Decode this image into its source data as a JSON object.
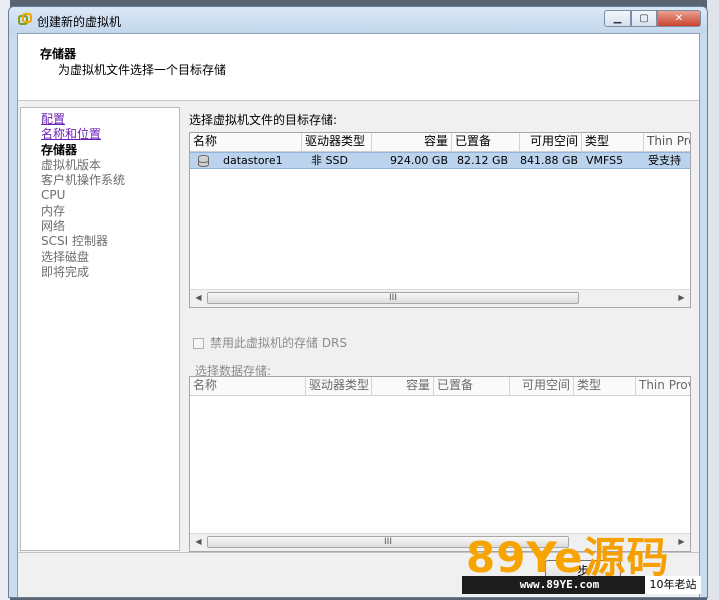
{
  "window": {
    "title": "创建新的虚拟机",
    "min_glyph": "▁",
    "max_glyph": "▢",
    "close_glyph": "✕"
  },
  "header": {
    "title": "存储器",
    "subtitle": "为虚拟机文件选择一个目标存储"
  },
  "nav": [
    {
      "label": "配置",
      "state": "link"
    },
    {
      "label": "名称和位置",
      "state": "link"
    },
    {
      "label": "存储器",
      "state": "current"
    },
    {
      "label": "虚拟机版本",
      "state": "normal"
    },
    {
      "label": "客户机操作系统",
      "state": "normal"
    },
    {
      "label": "CPU",
      "state": "normal"
    },
    {
      "label": "内存",
      "state": "normal"
    },
    {
      "label": "网络",
      "state": "normal"
    },
    {
      "label": "SCSI 控制器",
      "state": "normal"
    },
    {
      "label": "选择磁盘",
      "state": "normal"
    },
    {
      "label": "即将完成",
      "state": "normal"
    }
  ],
  "main": {
    "select_label": "选择虚拟机文件的目标存储:",
    "table": {
      "columns": [
        "名称",
        "驱动器类型",
        "容量",
        "已置备",
        "可用空间",
        "类型",
        "Thin Prov"
      ],
      "rows": [
        {
          "name": "datastore1",
          "drive_type": "非 SSD",
          "capacity": "924.00 GB",
          "provisioned": "82.12 GB",
          "free": "841.88 GB",
          "type": "VMFS5",
          "thin": "受支持"
        }
      ]
    },
    "disable_drs_label": "禁用此虚拟机的存储 DRS",
    "select_datastore_label": "选择数据存储:",
    "table2": {
      "columns": [
        "名称",
        "驱动器类型",
        "容量",
        "已置备",
        "可用空间",
        "类型",
        "Thin Provi"
      ]
    },
    "scroll_grip": "III",
    "scroll_left": "◀",
    "scroll_right": "▶"
  },
  "footer": {
    "next_partial": "步"
  },
  "watermark": {
    "brand": "89Ye",
    "brand_cn": "源码",
    "url": "www.89YE.com",
    "tag": "10年老站"
  },
  "colors": {
    "selected_row": "#bcd3ee",
    "link": "#6b1fb5",
    "watermark": "#f7a400"
  }
}
